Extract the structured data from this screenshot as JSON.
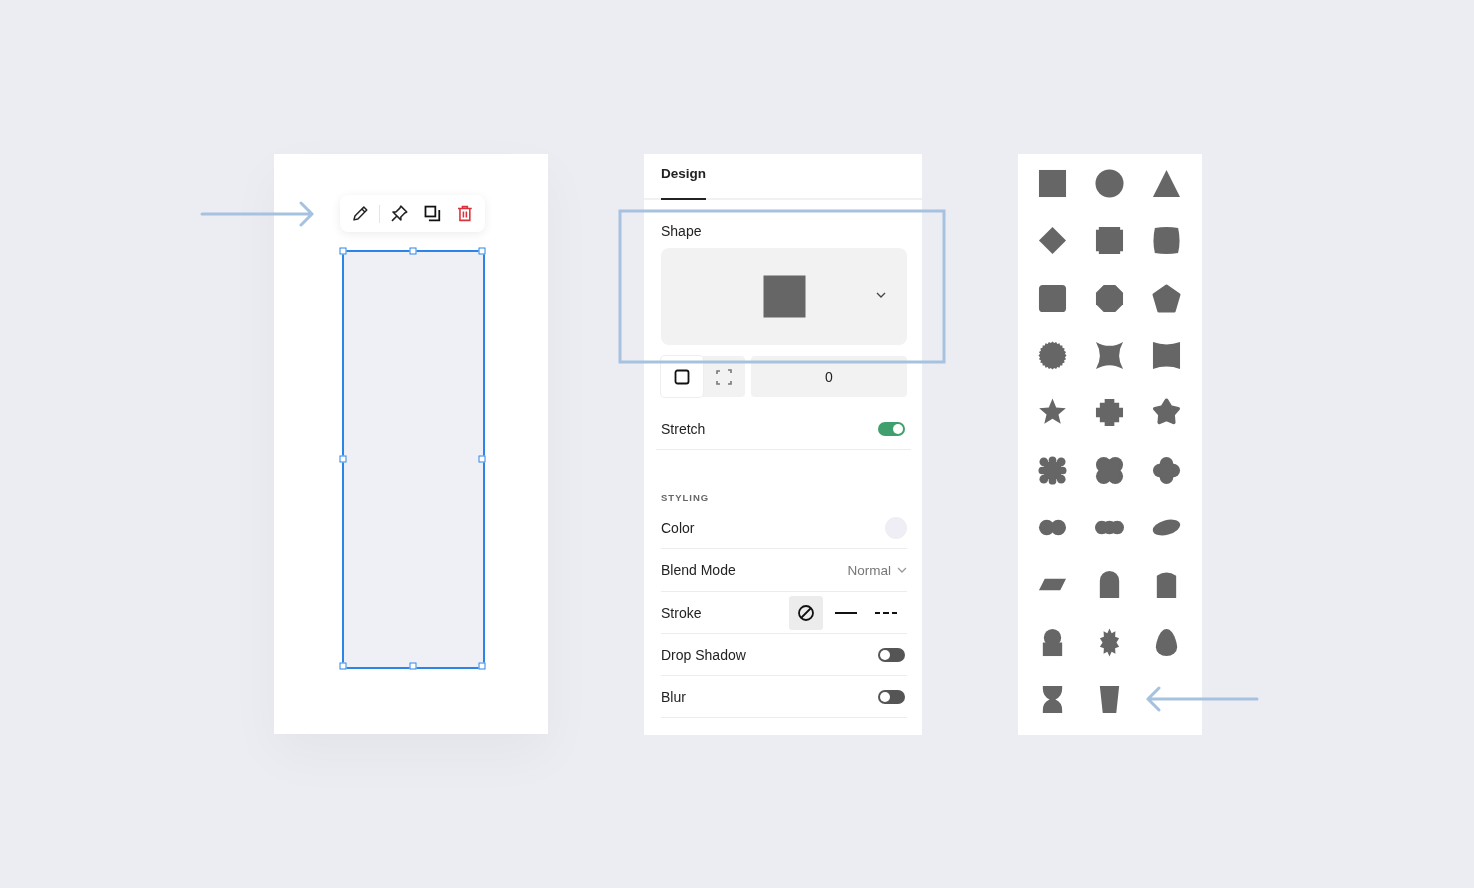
{
  "canvas": {
    "toolbar": [
      {
        "kind": "pencil"
      },
      {
        "kind": "pin"
      },
      {
        "kind": "duplicate"
      },
      {
        "kind": "delete"
      }
    ],
    "selection": {
      "selected": true
    }
  },
  "design_panel": {
    "tabs": [
      {
        "label": "Design",
        "selected": true
      }
    ],
    "shape": {
      "label": "Shape",
      "preview": {
        "kind": "square"
      },
      "corner_modes": [
        {
          "kind": "sharp",
          "selected": true
        },
        {
          "kind": "rounded",
          "selected": false
        }
      ],
      "corner_radius": "0"
    },
    "stretch": {
      "label": "Stretch",
      "on": true
    },
    "styling": {
      "heading": "STYLING",
      "color": {
        "label": "Color",
        "color": "#eeeef4"
      },
      "blend_mode": {
        "label": "Blend Mode",
        "value": "Normal"
      },
      "stroke": {
        "label": "Stroke",
        "options": [
          {
            "kind": "none",
            "selected": true
          },
          {
            "kind": "solid",
            "selected": false
          },
          {
            "kind": "dashed",
            "selected": false
          }
        ]
      },
      "drop_shadow": {
        "label": "Drop Shadow",
        "on": false
      },
      "blur": {
        "label": "Blur",
        "on": false
      }
    }
  },
  "shape_library": {
    "shapes": [
      {
        "kind": "square"
      },
      {
        "kind": "circle"
      },
      {
        "kind": "triangle"
      },
      {
        "kind": "diamond"
      },
      {
        "kind": "notched-square"
      },
      {
        "kind": "pillow"
      },
      {
        "kind": "rounded-square"
      },
      {
        "kind": "octagon"
      },
      {
        "kind": "pentagon"
      },
      {
        "kind": "seal"
      },
      {
        "kind": "four-point-star"
      },
      {
        "kind": "concave-rectangle"
      },
      {
        "kind": "star"
      },
      {
        "kind": "stepped-cross"
      },
      {
        "kind": "rounded-star"
      },
      {
        "kind": "scalloped-square"
      },
      {
        "kind": "quatrefoil"
      },
      {
        "kind": "clover"
      },
      {
        "kind": "double-circle"
      },
      {
        "kind": "triple-circle"
      },
      {
        "kind": "tilted-ellipse"
      },
      {
        "kind": "parallelogram"
      },
      {
        "kind": "arch"
      },
      {
        "kind": "tombstone"
      },
      {
        "kind": "keyhole"
      },
      {
        "kind": "burst"
      },
      {
        "kind": "egg"
      },
      {
        "kind": "hourglass"
      },
      {
        "kind": "tapered-cup"
      }
    ]
  }
}
